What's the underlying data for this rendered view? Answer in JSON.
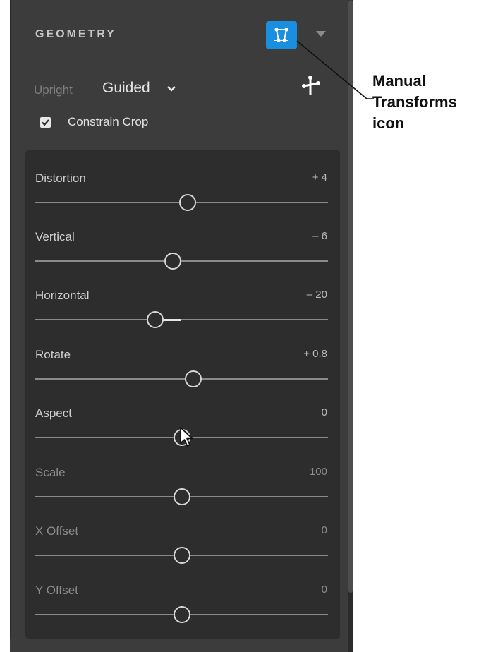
{
  "panel": {
    "title": "GEOMETRY",
    "upright_label": "Upright",
    "upright_value": "Guided",
    "constrain_crop_label": "Constrain Crop",
    "constrain_crop_checked": true
  },
  "sliders": [
    {
      "label": "Distortion",
      "value": "+ 4",
      "level": 0.52,
      "dim": false
    },
    {
      "label": "Vertical",
      "value": "– 6",
      "level": 0.47,
      "dim": false
    },
    {
      "label": "Horizontal",
      "value": "– 20",
      "level": 0.41,
      "fill_to": 0.5,
      "dim": false
    },
    {
      "label": "Rotate",
      "value": "+ 0.8",
      "level": 0.54,
      "dim": false
    },
    {
      "label": "Aspect",
      "value": "0",
      "level": 0.5,
      "dim": false
    },
    {
      "label": "Scale",
      "value": "100",
      "level": 0.5,
      "dim": true
    },
    {
      "label": "X Offset",
      "value": "0",
      "level": 0.5,
      "dim": true
    },
    {
      "label": "Y Offset",
      "value": "0",
      "level": 0.5,
      "dim": true
    }
  ],
  "callout": {
    "lines": [
      "Manual",
      "Transforms",
      "icon"
    ]
  },
  "colors": {
    "panel_bg": "#3c3c3c",
    "slider_box_bg": "#2d2d2d",
    "accent_blue": "#1a8fdf"
  },
  "icons": {
    "manual_transforms": "manual-transforms-icon",
    "collapse": "triangle-down-icon",
    "guided_tool": "guided-upright-tool-icon",
    "upright_dropdown": "chevron-down-icon",
    "cursor": "arrow-cursor-icon"
  }
}
